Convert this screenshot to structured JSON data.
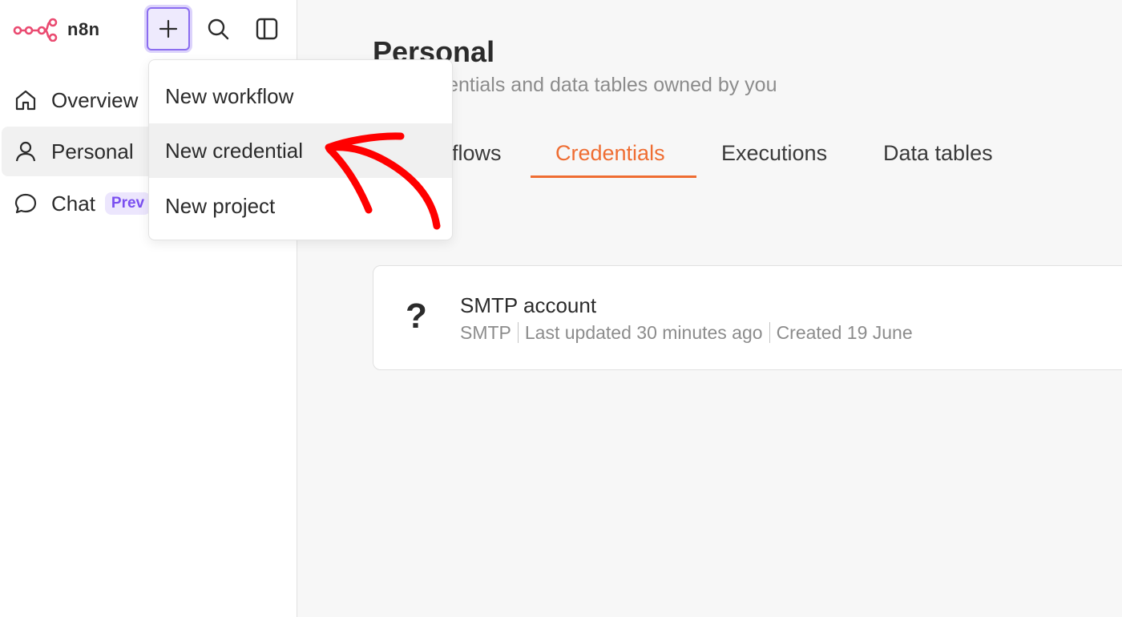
{
  "app": {
    "brand": "n8n"
  },
  "colors": {
    "accent": "#ef6d32",
    "brand": "#ea4b71",
    "preview_badge": "#7a4ff0",
    "annotation": "#ff0000"
  },
  "sidebar": {
    "items": [
      {
        "label": "Overview",
        "icon": "home-icon"
      },
      {
        "label": "Personal",
        "icon": "user-icon",
        "active": true
      },
      {
        "label": "Chat",
        "icon": "chat-icon",
        "badge": "Prev"
      }
    ]
  },
  "toolbar": {
    "add_icon": "plus-icon",
    "search_icon": "search-icon",
    "panel_icon": "sidebar-toggle-icon"
  },
  "menu": {
    "items": [
      {
        "label": "New workflow"
      },
      {
        "label": "New credential",
        "highlighted": true
      },
      {
        "label": "New project"
      }
    ]
  },
  "main": {
    "title": "Personal",
    "subtitle": "ws, credentials and data tables owned by you",
    "tabs": [
      {
        "label": "flows"
      },
      {
        "label": "Credentials",
        "active": true
      },
      {
        "label": "Executions"
      },
      {
        "label": "Data tables"
      }
    ]
  },
  "credential": {
    "icon": "?",
    "name": "SMTP account",
    "type": "SMTP",
    "updated": "Last updated 30 minutes ago",
    "created": "Created 19 June"
  }
}
